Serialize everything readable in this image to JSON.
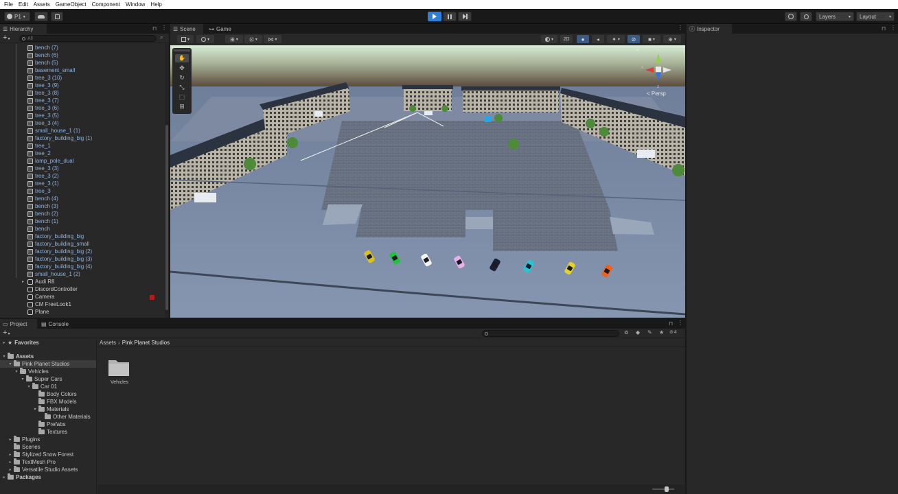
{
  "menu": [
    "File",
    "Edit",
    "Assets",
    "GameObject",
    "Component",
    "Window",
    "Help"
  ],
  "toolbar": {
    "account": "P1",
    "layers_label": "Layers",
    "layout_label": "Layout"
  },
  "hierarchy": {
    "tab": "Hierarchy",
    "search_placeholder": "All",
    "items": [
      {
        "label": "bench (7)",
        "type": "mesh"
      },
      {
        "label": "bench (6)",
        "type": "mesh"
      },
      {
        "label": "bench (5)",
        "type": "mesh"
      },
      {
        "label": "basement_small",
        "type": "mesh"
      },
      {
        "label": "tree_3 (10)",
        "type": "mesh"
      },
      {
        "label": "tree_3 (9)",
        "type": "mesh"
      },
      {
        "label": "tree_3 (8)",
        "type": "mesh"
      },
      {
        "label": "tree_3 (7)",
        "type": "mesh"
      },
      {
        "label": "tree_3 (6)",
        "type": "mesh"
      },
      {
        "label": "tree_3 (5)",
        "type": "mesh"
      },
      {
        "label": "tree_3 (4)",
        "type": "mesh"
      },
      {
        "label": "small_house_1 (1)",
        "type": "mesh"
      },
      {
        "label": "factory_building_big (1)",
        "type": "mesh"
      },
      {
        "label": "tree_1",
        "type": "mesh"
      },
      {
        "label": "tree_2",
        "type": "mesh"
      },
      {
        "label": "lamp_pole_dual",
        "type": "mesh"
      },
      {
        "label": "tree_3 (3)",
        "type": "mesh"
      },
      {
        "label": "tree_3 (2)",
        "type": "mesh"
      },
      {
        "label": "tree_3 (1)",
        "type": "mesh"
      },
      {
        "label": "tree_3",
        "type": "mesh"
      },
      {
        "label": "bench (4)",
        "type": "mesh"
      },
      {
        "label": "bench (3)",
        "type": "mesh"
      },
      {
        "label": "bench (2)",
        "type": "mesh"
      },
      {
        "label": "bench (1)",
        "type": "mesh"
      },
      {
        "label": "bench",
        "type": "mesh"
      },
      {
        "label": "factory_building_big",
        "type": "mesh"
      },
      {
        "label": "factory_building_small",
        "type": "mesh"
      },
      {
        "label": "factory_building_big (2)",
        "type": "mesh"
      },
      {
        "label": "factory_building_big (3)",
        "type": "mesh"
      },
      {
        "label": "factory_building_big (4)",
        "type": "mesh"
      },
      {
        "label": "small_house_1 (2)",
        "type": "mesh"
      },
      {
        "label": "Audi R8",
        "type": "go"
      },
      {
        "label": "DiscordController",
        "type": "go"
      },
      {
        "label": "Camera",
        "type": "go"
      },
      {
        "label": "CM FreeLook1",
        "type": "go"
      },
      {
        "label": "Plane",
        "type": "go"
      }
    ]
  },
  "scene": {
    "tabs": [
      "Scene",
      "Game"
    ],
    "toggle_2d": "2D",
    "persp_label": "< Persp",
    "gizmo_axes": [
      "y",
      "x",
      "z"
    ]
  },
  "inspector": {
    "tab": "Inspector"
  },
  "project": {
    "tabs": [
      "Project",
      "Console"
    ],
    "badge_count": "4",
    "favorites": "Favorites",
    "breadcrumb": [
      "Assets",
      "Pink Planet Studios"
    ],
    "tree": [
      {
        "label": "Assets",
        "depth": 0,
        "arrow": "down"
      },
      {
        "label": "Pink Planet Studios",
        "depth": 1,
        "arrow": "down",
        "selected": true
      },
      {
        "label": "Vehicles",
        "depth": 2,
        "arrow": "down"
      },
      {
        "label": "Super Cars",
        "depth": 3,
        "arrow": "down"
      },
      {
        "label": "Car 01",
        "depth": 4,
        "arrow": "down"
      },
      {
        "label": "Body Colors",
        "depth": 5,
        "arrow": ""
      },
      {
        "label": "FBX Models",
        "depth": 5,
        "arrow": ""
      },
      {
        "label": "Materials",
        "depth": 5,
        "arrow": "down"
      },
      {
        "label": "Other Materials",
        "depth": 6,
        "arrow": ""
      },
      {
        "label": "Prefabs",
        "depth": 5,
        "arrow": ""
      },
      {
        "label": "Textures",
        "depth": 5,
        "arrow": ""
      },
      {
        "label": "Plugins",
        "depth": 1,
        "arrow": "right"
      },
      {
        "label": "Scenes",
        "depth": 1,
        "arrow": ""
      },
      {
        "label": "Stylized Snow Forest",
        "depth": 1,
        "arrow": "right"
      },
      {
        "label": "TextMesh Pro",
        "depth": 1,
        "arrow": "right"
      },
      {
        "label": "Versatile Studio Assets",
        "depth": 1,
        "arrow": "right"
      },
      {
        "label": "Packages",
        "depth": 0,
        "arrow": "right"
      }
    ],
    "grid_items": [
      {
        "label": "Vehicles"
      }
    ]
  },
  "colors": {
    "accent_blue": "#2f7fd8",
    "car_colors": [
      "#d9c31a",
      "#1fc43a",
      "#f2f2f2",
      "#e8b0e6",
      "#1b1f33",
      "#22c6d6",
      "#e6d226",
      "#f0611e"
    ]
  }
}
